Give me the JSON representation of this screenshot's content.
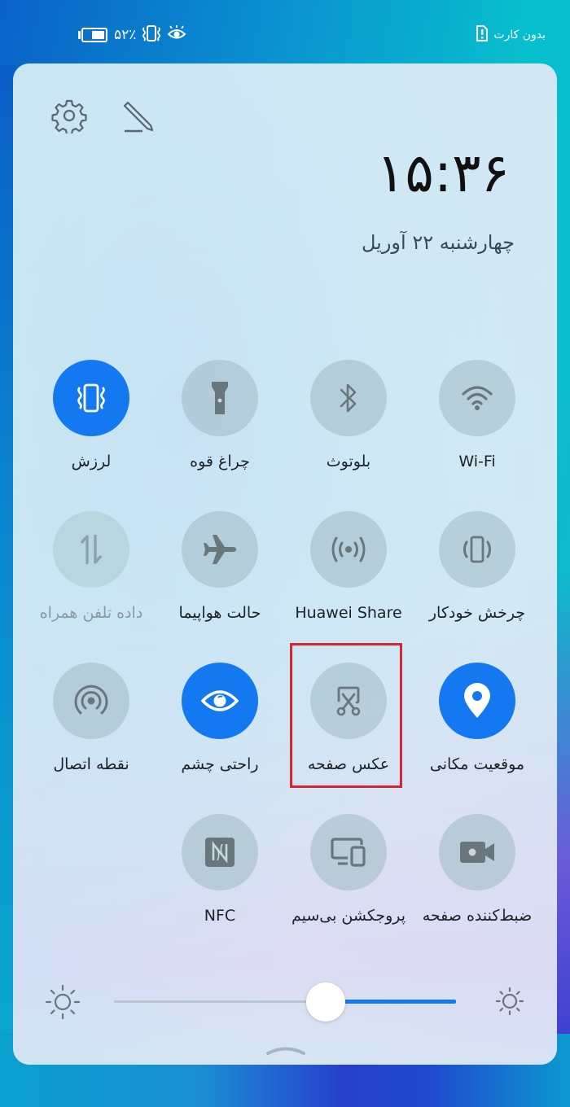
{
  "status_bar": {
    "battery_percent_text": "۵۲٪",
    "battery_level": 0.52,
    "left_icons": [
      "battery-icon",
      "vibrate-mode-icon",
      "eye-comfort-icon"
    ],
    "sim_status": "بدون کارت",
    "sim_icon": "no-sim-card-icon"
  },
  "header": {
    "settings_icon": "gear-icon",
    "edit_icon": "pencil-icon",
    "time": "۱۵:۳۶",
    "date": "چهارشنبه ۲۲ آوریل"
  },
  "tiles": [
    {
      "id": "wifi",
      "label": "Wi-Fi",
      "icon": "wifi-icon",
      "state": "off"
    },
    {
      "id": "bluetooth",
      "label": "بلوتوث",
      "icon": "bluetooth-icon",
      "state": "off"
    },
    {
      "id": "flashlight",
      "label": "چراغ قوه",
      "icon": "flashlight-icon",
      "state": "off"
    },
    {
      "id": "vibrate",
      "label": "لرزش",
      "icon": "vibrate-icon",
      "state": "on"
    },
    {
      "id": "auto-rotate",
      "label": "چرخش خودکار",
      "icon": "auto-rotate-icon",
      "state": "off"
    },
    {
      "id": "huawei-share",
      "label": "Huawei Share",
      "icon": "broadcast-icon",
      "state": "off"
    },
    {
      "id": "airplane",
      "label": "حالت هواپیما",
      "icon": "airplane-icon",
      "state": "off"
    },
    {
      "id": "mobile-data",
      "label": "داده تلفن همراه",
      "icon": "mobile-data-icon",
      "state": "disabled"
    },
    {
      "id": "location",
      "label": "موقعیت مکانی",
      "icon": "location-pin-icon",
      "state": "on"
    },
    {
      "id": "screenshot",
      "label": "عکس صفحه",
      "icon": "screenshot-scissors-icon",
      "state": "off",
      "highlighted": true
    },
    {
      "id": "eye-comfort",
      "label": "راحتی چشم",
      "icon": "eye-icon",
      "state": "on"
    },
    {
      "id": "hotspot",
      "label": "نقطه اتصال",
      "icon": "hotspot-icon",
      "state": "off"
    },
    {
      "id": "screen-recorder",
      "label": "ضبط‌کننده صفحه",
      "icon": "video-camera-icon",
      "state": "off"
    },
    {
      "id": "wireless-projection",
      "label": "پروجکشن بی‌سیم",
      "icon": "wireless-projection-icon",
      "state": "off"
    },
    {
      "id": "nfc",
      "label": "NFC",
      "icon": "nfc-icon",
      "state": "off"
    }
  ],
  "brightness": {
    "low_icon": "brightness-low-icon",
    "high_icon": "brightness-high-icon",
    "level": 0.62
  },
  "colors": {
    "accent": "#1479f0",
    "highlight_border": "#d8252e",
    "tile_off": "#a9bec6"
  },
  "collapse_handle_icon": "chevron-up-icon"
}
